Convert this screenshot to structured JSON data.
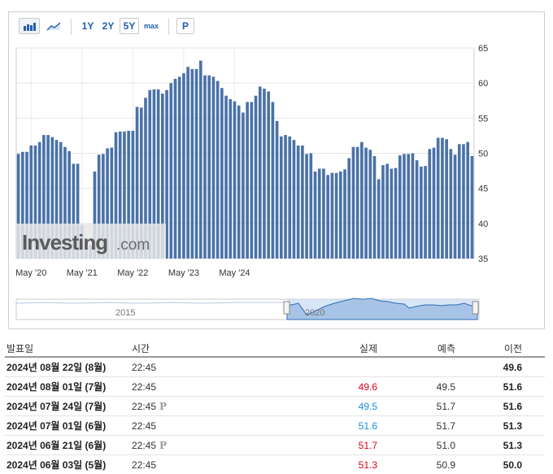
{
  "toolbar": {
    "bar_chart_icon": "bar-chart-icon",
    "line_chart_icon": "line-chart-icon",
    "ranges": [
      "1Y",
      "2Y",
      "5Y",
      "max"
    ],
    "selected_range": "5Y",
    "preliminary_button": "P"
  },
  "chart_data": {
    "type": "bar",
    "bar_color": "#4a72a8",
    "y_ticks": [
      "65",
      "60",
      "55",
      "50",
      "45",
      "40",
      "35"
    ],
    "ylim": [
      35,
      65
    ],
    "x_ticks": [
      "May '20",
      "May '21",
      "May '22",
      "May '23",
      "May '24"
    ],
    "values": [
      49.9,
      50.2,
      50.2,
      51.1,
      51.1,
      51.6,
      52.6,
      52.6,
      52.3,
      51.9,
      51.6,
      50.9,
      50.3,
      48.5,
      48.5,
      39.8,
      36.4,
      36.9,
      47.4,
      49.8,
      49.9,
      50.7,
      50.8,
      53.0,
      53.1,
      53.1,
      53.2,
      53.2,
      56.6,
      56.5,
      57.9,
      59.0,
      59.1,
      59.1,
      58.5,
      59.0,
      60.0,
      60.6,
      60.9,
      61.4,
      62.3,
      62.0,
      62.0,
      63.2,
      61.1,
      61.1,
      60.9,
      60.3,
      59.3,
      58.2,
      57.7,
      57.4,
      56.8,
      55.8,
      57.3,
      57.3,
      58.2,
      59.5,
      59.2,
      58.8,
      57.3,
      54.6,
      52.4,
      52.6,
      52.4,
      51.9,
      51.1,
      51.1,
      49.9,
      50.0,
      47.4,
      47.8,
      47.8,
      46.9,
      47.2,
      47.2,
      47.4,
      47.7,
      49.3,
      50.9,
      50.9,
      51.6,
      50.8,
      50.5,
      49.6,
      46.3,
      48.3,
      48.5,
      47.8,
      47.9,
      49.7,
      49.9,
      49.9,
      50.0,
      49.0,
      48.1,
      48.2,
      50.6,
      50.8,
      52.2,
      52.2,
      52.0,
      50.6,
      49.8,
      51.3,
      51.3,
      51.6,
      49.6
    ],
    "navigator_labels": [
      "2015",
      "2020"
    ]
  },
  "watermark": {
    "brand": "Investing",
    "suffix": ".com"
  },
  "table": {
    "headers": {
      "date": "발표일",
      "time": "시간",
      "actual": "실제",
      "forecast": "예측",
      "previous": "이전"
    },
    "rows": [
      {
        "date": "2024년 08월 22일 (8월)",
        "time": "22:45",
        "actual": "",
        "forecast": "",
        "previous": "49.6",
        "prelim": ""
      },
      {
        "date": "2024년 08월 01일 (7월)",
        "time": "22:45",
        "actual": "49.6",
        "forecast": "49.5",
        "previous": "51.6",
        "prelim": ""
      },
      {
        "date": "2024년 07월 24일 (7월)",
        "time": "22:45",
        "actual": "49.5",
        "forecast": "51.7",
        "previous": "51.6",
        "prelim": "P"
      },
      {
        "date": "2024년 07월 01일 (6월)",
        "time": "22:45",
        "actual": "51.6",
        "forecast": "51.7",
        "previous": "51.3",
        "prelim": ""
      },
      {
        "date": "2024년 06월 21일 (6월)",
        "time": "22:45",
        "actual": "51.7",
        "forecast": "51.0",
        "previous": "51.3",
        "prelim": "P"
      },
      {
        "date": "2024년 06월 03일 (5월)",
        "time": "22:45",
        "actual": "51.3",
        "forecast": "50.9",
        "previous": "50.0",
        "prelim": ""
      }
    ],
    "colors": {
      "negative": "#e0001a",
      "positive": "#1a8fd8"
    }
  }
}
